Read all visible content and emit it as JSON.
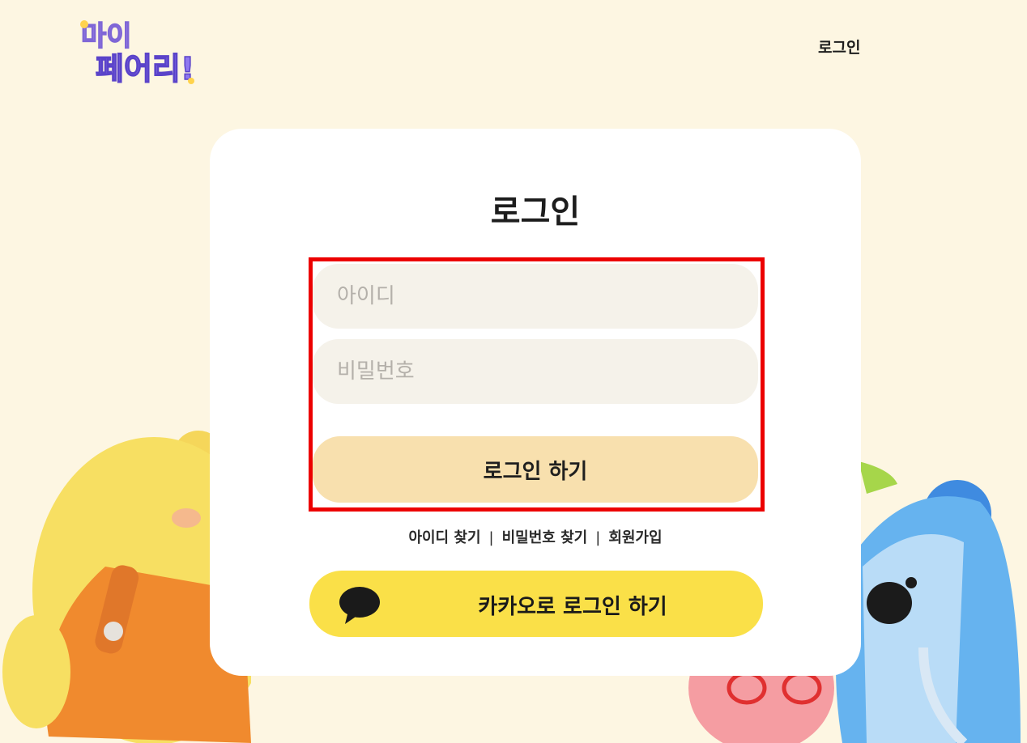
{
  "header": {
    "logo_text_line1": "마이",
    "logo_text_line2": "페어리!",
    "login_link": "로그인"
  },
  "login_card": {
    "title": "로그인",
    "id_placeholder": "아이디",
    "password_placeholder": "비밀번호",
    "submit_label": "로그인 하기",
    "links": {
      "find_id": "아이디 찾기",
      "find_password": "비밀번호 찾기",
      "signup": "회원가입",
      "separator": "|"
    },
    "kakao_label": "카카오로 로그인 하기"
  },
  "colors": {
    "background": "#fdf6e2",
    "card": "#ffffff",
    "input_bg": "#f5f2ea",
    "login_button": "#f8e0ae",
    "kakao_button": "#fae048",
    "highlight_border": "#ec0000"
  }
}
